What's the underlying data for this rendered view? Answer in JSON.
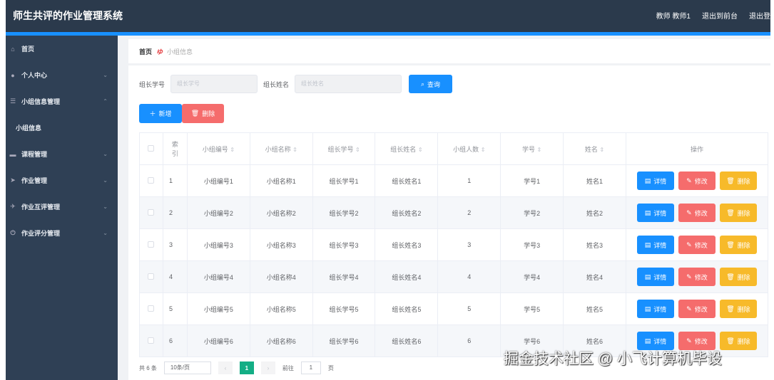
{
  "header": {
    "title": "师生共评的作业管理系统",
    "user": "教师 教师1",
    "front": "退出到前台",
    "logout": "退出登"
  },
  "sidebar": [
    {
      "icon": "home-icon",
      "glyph": "⌂",
      "label": "首页",
      "chev": ""
    },
    {
      "icon": "user-icon",
      "glyph": "●",
      "label": "个人中心",
      "chev": "⌄"
    },
    {
      "icon": "list-icon",
      "glyph": "☰",
      "label": "小组信息管理",
      "chev": "⌃"
    },
    {
      "icon": "",
      "glyph": "",
      "label": "小组信息",
      "chev": ""
    },
    {
      "icon": "monitor-icon",
      "glyph": "▬",
      "label": "课程管理",
      "chev": "⌄"
    },
    {
      "icon": "send-icon",
      "glyph": "➤",
      "label": "作业管理",
      "chev": "⌄"
    },
    {
      "icon": "plane-icon",
      "glyph": "✈",
      "label": "作业互评管理",
      "chev": "⌄"
    },
    {
      "icon": "power-icon",
      "glyph": "⏻",
      "label": "作业评分管理",
      "chev": "⌄"
    }
  ],
  "breadcrumb": {
    "home": "首页",
    "sep": "ゆ",
    "current": "小组信息"
  },
  "search": {
    "label1": "组长学号",
    "placeholder1": "组长学号",
    "label2": "组长姓名",
    "placeholder2": "组长姓名",
    "button": "查询"
  },
  "actions": {
    "add": "新增",
    "delete": "删除"
  },
  "table": {
    "headers": [
      "索引",
      "小组编号",
      "小组名称",
      "组长学号",
      "组长姓名",
      "小组人数",
      "学号",
      "姓名",
      "操作"
    ],
    "rows": [
      [
        "1",
        "小组编号1",
        "小组名称1",
        "组长学号1",
        "组长姓名1",
        "1",
        "学号1",
        "姓名1"
      ],
      [
        "2",
        "小组编号2",
        "小组名称2",
        "组长学号2",
        "组长姓名2",
        "2",
        "学号2",
        "姓名2"
      ],
      [
        "3",
        "小组编号3",
        "小组名称3",
        "组长学号3",
        "组长姓名3",
        "3",
        "学号3",
        "姓名3"
      ],
      [
        "4",
        "小组编号4",
        "小组名称4",
        "组长学号4",
        "组长姓名4",
        "4",
        "学号4",
        "姓名4"
      ],
      [
        "5",
        "小组编号5",
        "小组名称5",
        "组长学号5",
        "组长姓名5",
        "5",
        "学号5",
        "姓名5"
      ],
      [
        "6",
        "小组编号6",
        "小组名称6",
        "组长学号6",
        "组长姓名6",
        "6",
        "学号6",
        "姓名6"
      ]
    ],
    "ops": {
      "detail": "详情",
      "edit": "修改",
      "delete": "删除"
    }
  },
  "pager": {
    "total": "共 6 条",
    "size": "10条/页",
    "page": "1",
    "goto": "前往",
    "goto_val": "1",
    "unit": "页"
  },
  "watermark": "掘金技术社区 @ 小飞计算机毕设"
}
